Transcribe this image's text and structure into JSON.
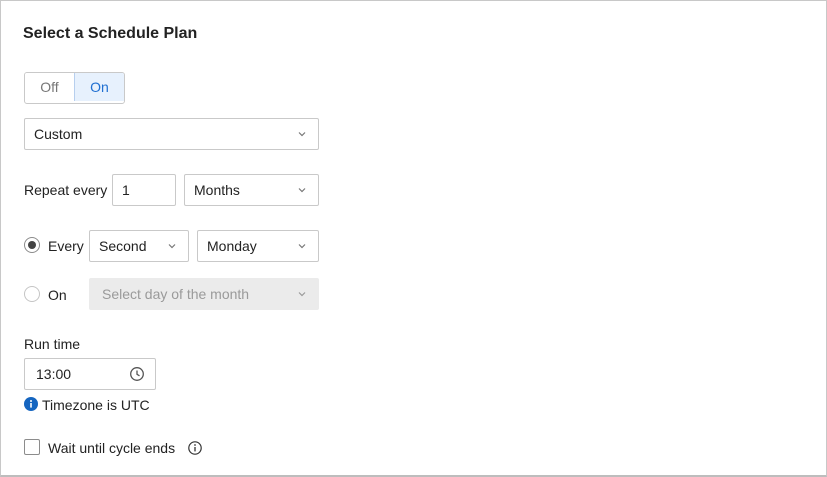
{
  "header": {
    "title": "Select a Schedule Plan"
  },
  "toggle": {
    "off_label": "Off",
    "on_label": "On",
    "selected": "On"
  },
  "plan_select": {
    "value": "Custom"
  },
  "repeat": {
    "label": "Repeat every",
    "count": "1",
    "unit": "Months"
  },
  "every_option": {
    "label": "Every",
    "checked": true,
    "ordinal": "Second",
    "weekday": "Monday"
  },
  "on_option": {
    "label": "On",
    "checked": false,
    "day_placeholder": "Select day of the month"
  },
  "run_time": {
    "label": "Run time",
    "value": "13:00",
    "timezone_note": "Timezone is UTC"
  },
  "wait_cycle": {
    "label": "Wait until cycle ends",
    "checked": false
  },
  "colors": {
    "accent": "#1f6fd1",
    "info_blue": "#1565c0",
    "toggle_active_bg": "#e7f1fd",
    "disabled_bg": "#ebebeb"
  },
  "icons": {
    "select_arrow": "chevron-down-icon",
    "time": "clock-icon",
    "timezone": "info-filled-icon",
    "wait_help": "info-outline-icon"
  }
}
